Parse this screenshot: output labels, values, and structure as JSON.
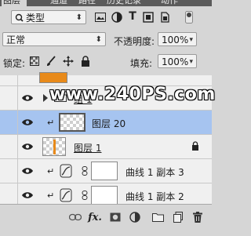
{
  "tabs": [
    "图层",
    "通道",
    "路径",
    "历史记录",
    "动作"
  ],
  "filter": {
    "kind_label": "类型"
  },
  "blend": {
    "mode": "正常",
    "opacity_label": "不透明度:",
    "opacity_value": "100%"
  },
  "lock": {
    "label": "锁定:",
    "fill_label": "填充:",
    "fill_value": "100%"
  },
  "layers": [
    {
      "name": "组 1"
    },
    {
      "name": "图层 20"
    },
    {
      "name": "图层 1"
    },
    {
      "name": "曲线 1 副本 3"
    },
    {
      "name": "曲线 1 副本 2"
    }
  ],
  "watermark": "www.240PS.com",
  "colors": {
    "selected_row": "#a6c4f0",
    "orange_thumb": "#e88a1a",
    "panel_bg": "#d6d6d6"
  }
}
